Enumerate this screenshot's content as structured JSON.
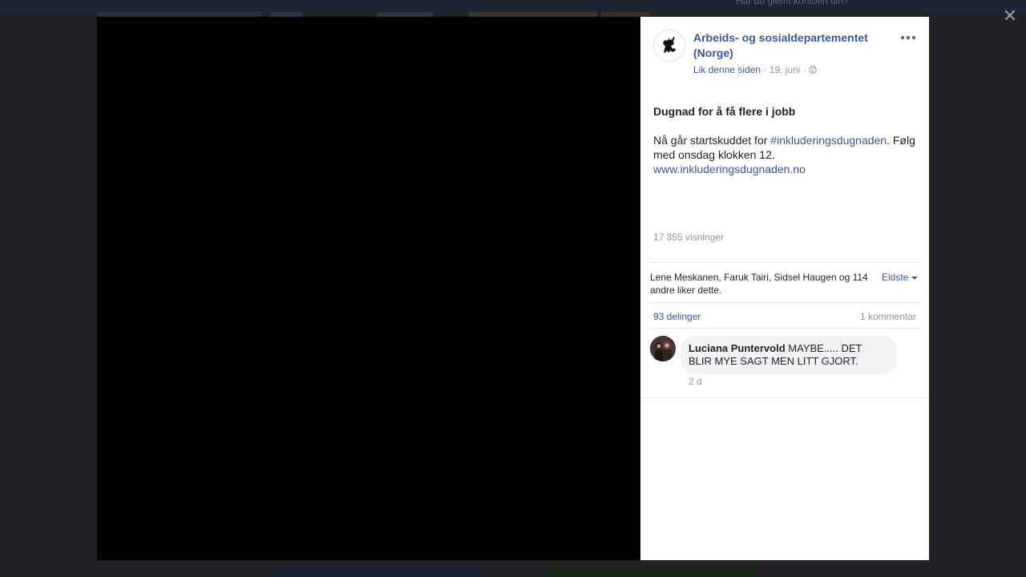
{
  "background": {
    "header_text": "Har du glemt kontoen din?"
  },
  "post": {
    "page_name": "Arbeids- og sosialdepartementet (Norge)",
    "like_page_label": "Lik denne siden",
    "date": "19. juni",
    "title": "Dugnad for å få flere i jobb",
    "body_before_hashtag": "Nå går startskuddet for ",
    "hashtag": "#inkluderingsdugnaden",
    "body_after_hashtag": ". Følg med onsdag klokken 12.",
    "website": "www.inkluderingsdugnaden.no",
    "views": "17 355 visninger"
  },
  "reactions": {
    "likes_text": "Lene Meskanen, Faruk Tairi, Sidsel Haugen og 114 andre liker dette.",
    "sort_label": "Eldste",
    "shares": "93 delinger",
    "comments_count": "1 kommentar"
  },
  "comments": [
    {
      "author": "Luciana Puntervold",
      "text": "MAYBE..... DET BLIR MYE SAGT MEN LITT GJORT.",
      "time": "2 d"
    }
  ],
  "icons": {
    "close": "close-icon",
    "more": "more-options-icon",
    "audience": "globe-icon",
    "page_logo": "norwegian-lion-crest-icon"
  },
  "colors": {
    "link": "#385898",
    "text": "#1d2129",
    "secondary_text": "#90949c",
    "overlay": "#202226"
  }
}
